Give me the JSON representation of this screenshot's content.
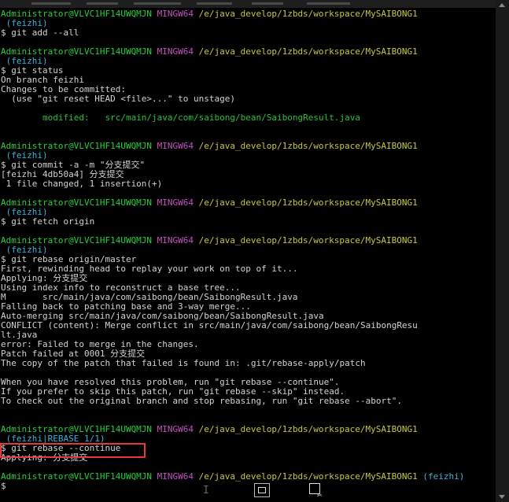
{
  "prompt_user": "Administrator@VLVC1HF14UWQMJN",
  "prompt_shell": "MINGW64",
  "prompt_path": "/e/java_develop/1zbds/workspace/MySAIBONG1",
  "lines": [
    {
      "kind": "prompt"
    },
    {
      "kind": "branch",
      "text": "(feizhi)"
    },
    {
      "kind": "cmd",
      "text": "$ git add --all"
    },
    {
      "kind": "blank"
    },
    {
      "kind": "prompt"
    },
    {
      "kind": "branch",
      "text": "(feizhi)"
    },
    {
      "kind": "cmd",
      "text": "$ git status"
    },
    {
      "kind": "text",
      "text": "On branch feizhi"
    },
    {
      "kind": "text",
      "text": "Changes to be committed:"
    },
    {
      "kind": "text",
      "text": "  (use \"git reset HEAD <file>...\" to unstage)"
    },
    {
      "kind": "blank"
    },
    {
      "kind": "modified",
      "label": "        modified:   ",
      "text": "src/main/java/com/saibong/bean/SaibongResult.java"
    },
    {
      "kind": "blank"
    },
    {
      "kind": "blank"
    },
    {
      "kind": "prompt"
    },
    {
      "kind": "branch",
      "text": "(feizhi)"
    },
    {
      "kind": "cmd",
      "text": "$ git commit -a -m \"分支提交\""
    },
    {
      "kind": "text",
      "text": "[feizhi 4db50a4] 分支提交"
    },
    {
      "kind": "text",
      "text": " 1 file changed, 1 insertion(+)"
    },
    {
      "kind": "blank"
    },
    {
      "kind": "prompt"
    },
    {
      "kind": "branch",
      "text": "(feizhi)"
    },
    {
      "kind": "cmd",
      "text": "$ git fetch origin"
    },
    {
      "kind": "blank"
    },
    {
      "kind": "prompt"
    },
    {
      "kind": "branch",
      "text": "(feizhi)"
    },
    {
      "kind": "cmd",
      "text": "$ git rebase origin/master"
    },
    {
      "kind": "text",
      "text": "First, rewinding head to replay your work on top of it..."
    },
    {
      "kind": "text",
      "text": "Applying: 分支提交"
    },
    {
      "kind": "text",
      "text": "Using index info to reconstruct a base tree..."
    },
    {
      "kind": "text",
      "text": "M       src/main/java/com/saibong/bean/SaibongResult.java"
    },
    {
      "kind": "text",
      "text": "Falling back to patching base and 3-way merge..."
    },
    {
      "kind": "text",
      "text": "Auto-merging src/main/java/com/saibong/bean/SaibongResult.java"
    },
    {
      "kind": "text",
      "text": "CONFLICT (content): Merge conflict in src/main/java/com/saibong/bean/SaibongResu"
    },
    {
      "kind": "text",
      "text": "lt.java"
    },
    {
      "kind": "text",
      "text": "error: Failed to merge in the changes."
    },
    {
      "kind": "text",
      "text": "Patch failed at 0001 分支提交"
    },
    {
      "kind": "text",
      "text": "The copy of the patch that failed is found in: .git/rebase-apply/patch"
    },
    {
      "kind": "blank"
    },
    {
      "kind": "text",
      "text": "When you have resolved this problem, run \"git rebase --continue\"."
    },
    {
      "kind": "text",
      "text": "If you prefer to skip this patch, run \"git rebase --skip\" instead."
    },
    {
      "kind": "text",
      "text": "To check out the original branch and stop rebasing, run \"git rebase --abort\"."
    },
    {
      "kind": "blank"
    },
    {
      "kind": "blank"
    },
    {
      "kind": "prompt"
    },
    {
      "kind": "branch",
      "text": "(feizhi|REBASE 1/1)"
    },
    {
      "kind": "cmd",
      "text": "$ git rebase --continue"
    },
    {
      "kind": "text",
      "text": "Applying: 分支提交"
    },
    {
      "kind": "blank"
    },
    {
      "kind": "prompt_inline",
      "branch": "(feizhi)"
    },
    {
      "kind": "cmd",
      "text": "$"
    }
  ],
  "highlighted_command": "$ git rebase --continue",
  "status_cursor_glyph": "I",
  "colors": {
    "user": "#23d13a",
    "shell": "#c54ec5",
    "path": "#c8c83a",
    "branch": "#38b3d8",
    "highlight": "#e23a3a",
    "background": "#000000"
  },
  "icons": {
    "fit": "fit-window-icon",
    "resize": "resize-window-icon",
    "scroll_up": "scroll-up-arrow",
    "scroll_down": "scroll-down-arrow"
  }
}
